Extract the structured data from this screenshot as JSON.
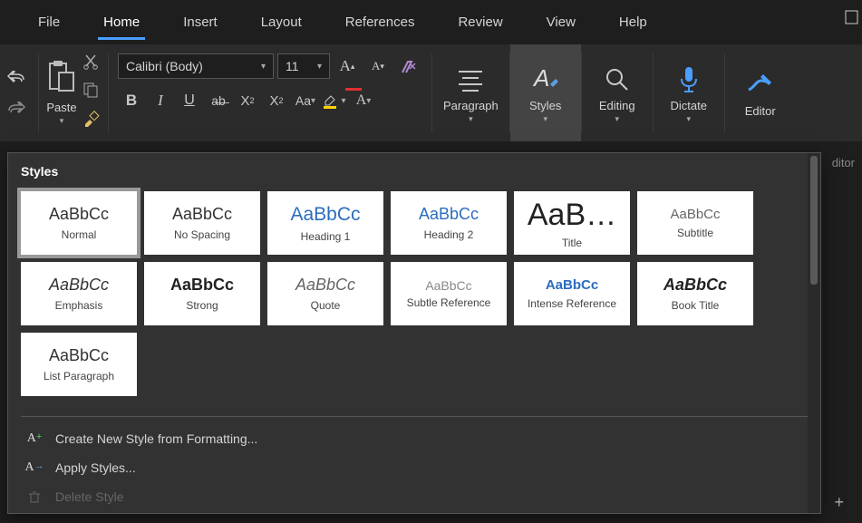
{
  "tabs": [
    "File",
    "Home",
    "Insert",
    "Layout",
    "References",
    "Review",
    "View",
    "Help"
  ],
  "activeTab": "Home",
  "paste": {
    "label": "Paste"
  },
  "font": {
    "name": "Calibri (Body)",
    "size": "11"
  },
  "bigButtons": {
    "paragraph": "Paragraph",
    "styles": "Styles",
    "editing": "Editing",
    "dictate": "Dictate",
    "editor": "Editor"
  },
  "stylesPanel": {
    "title": "Styles",
    "styles": [
      {
        "sample": "AaBbCc",
        "name": "Normal",
        "css": "font-family: sans-serif; color:#333;",
        "selected": true
      },
      {
        "sample": "AaBbCc",
        "name": "No Spacing",
        "css": "font-family: sans-serif; color:#333;"
      },
      {
        "sample": "AaBbCc",
        "name": "Heading 1",
        "css": "font-family: sans-serif; color:#2a6dbf; font-size:21px;"
      },
      {
        "sample": "AaBbCc",
        "name": "Heading 2",
        "css": "font-family: sans-serif; color:#2a6dbf; font-size:18px;"
      },
      {
        "sample": "AaB…",
        "name": "Title",
        "css": "font-family: sans-serif; color:#222; font-size:34px;"
      },
      {
        "sample": "AaBbCc",
        "name": "Subtitle",
        "css": "font-family: sans-serif; color:#666; font-size:15px;"
      },
      {
        "sample": "AaBbCc",
        "name": "Emphasis",
        "css": "font-family: sans-serif; font-style:italic; color:#333;"
      },
      {
        "sample": "AaBbCc",
        "name": "Strong",
        "css": "font-family: sans-serif; font-weight:bold; color:#222;"
      },
      {
        "sample": "AaBbCc",
        "name": "Quote",
        "css": "font-family: sans-serif; font-style:italic; color:#666;"
      },
      {
        "sample": "AaBbCc",
        "name": "Subtle Reference",
        "css": "font-family: sans-serif; color:#888; font-size:14px;"
      },
      {
        "sample": "AaBbCc",
        "name": "Intense Reference",
        "css": "font-family: sans-serif; font-weight:bold; color:#2a6dbf; font-size:15px;"
      },
      {
        "sample": "AaBbCc",
        "name": "Book Title",
        "css": "font-family: sans-serif; font-weight:bold; font-style:italic; color:#222;"
      },
      {
        "sample": "AaBbCc",
        "name": "List Paragraph",
        "css": "font-family: sans-serif; color:#333;"
      }
    ],
    "actions": {
      "create": "Create New Style from Formatting...",
      "apply": "Apply Styles...",
      "delete": "Delete Style"
    }
  },
  "bgText": "ditor"
}
